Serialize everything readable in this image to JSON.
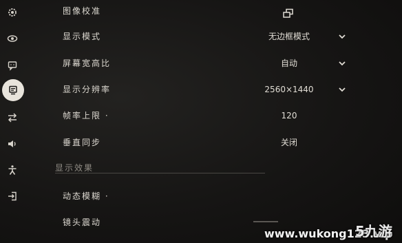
{
  "sidebar": {
    "items": [
      {
        "icon": "gear-icon"
      },
      {
        "icon": "eye-icon"
      },
      {
        "icon": "chat-icon"
      },
      {
        "icon": "display-settings-icon",
        "active": true
      },
      {
        "icon": "swap-arrows-icon"
      },
      {
        "icon": "speaker-icon"
      },
      {
        "icon": "accessibility-person-icon"
      },
      {
        "icon": "exit-icon"
      }
    ]
  },
  "settings": {
    "calibration": {
      "label": "图像校准",
      "icon": "copy-windows-icon"
    },
    "display_mode": {
      "label": "显示模式",
      "value": "无边框模式"
    },
    "aspect_ratio": {
      "label": "屏幕宽高比",
      "value": "自动"
    },
    "resolution": {
      "label": "显示分辨率",
      "value": "2560×1440"
    },
    "frame_limit": {
      "label": "帧率上限 ·",
      "value": "120"
    },
    "vsync": {
      "label": "垂直同步",
      "value": "关闭"
    }
  },
  "effects_section": {
    "title": "显示效果",
    "motion_blur": {
      "label": "动态模糊 ·"
    },
    "camera_shake": {
      "label": "镜头震动"
    }
  },
  "watermark": {
    "text": "www.wukong123.vip",
    "logo": "5九游"
  }
}
